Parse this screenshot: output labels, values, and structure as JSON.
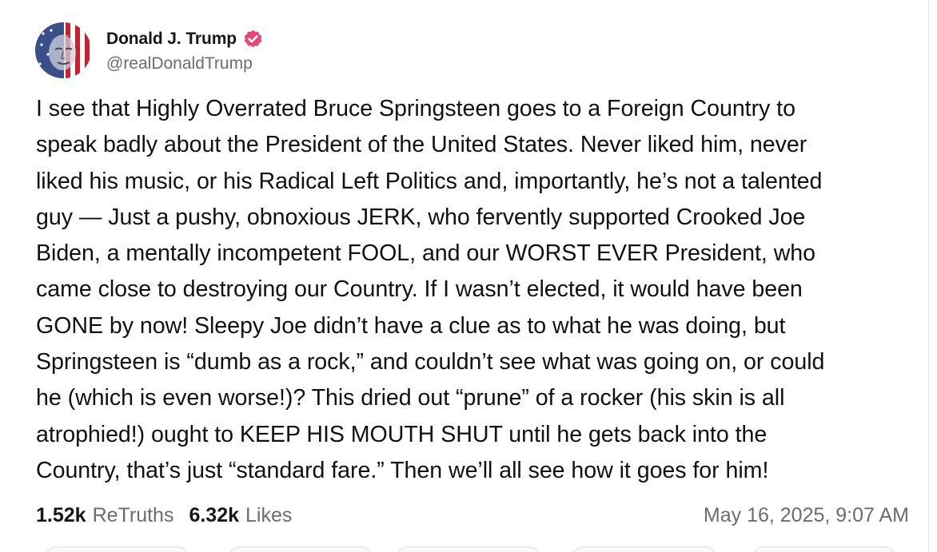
{
  "post": {
    "author": {
      "display_name": "Donald J. Trump",
      "handle": "@realDonaldTrump",
      "verified_icon": "verified-badge-icon",
      "verified_color": "#e4487a"
    },
    "lines": [
      "I see that Highly Overrated Bruce Springsteen goes to a Foreign Country to",
      "speak badly about the President of the United States. Never liked him, never",
      "liked his music, or his Radical Left Politics and, importantly, he’s not a talented",
      "guy — Just a pushy, obnoxious JERK, who fervently supported Crooked Joe",
      "Biden, a mentally incompetent FOOL, and our WORST EVER President, who",
      "came close to destroying our Country. If I wasn’t elected, it would have been",
      "GONE by now! Sleepy Joe didn’t have a clue as to what he was doing, but",
      "Springsteen is “dumb as a rock,” and couldn’t see what was going on, or could",
      "he (which is even worse!)? This dried out “prune” of a rocker (his skin is all",
      "atrophied!) ought to KEEP HIS MOUTH SHUT until he gets back into the",
      "Country, that’s just “standard fare.” Then we’ll all see how it goes for him!"
    ],
    "stats": {
      "retruths_count": "1.52k",
      "retruths_label": "ReTruths",
      "likes_count": "6.32k",
      "likes_label": "Likes"
    },
    "timestamp": "May 16, 2025, 9:07 AM"
  },
  "colors": {
    "text": "#111114",
    "muted": "#6b6b76",
    "border": "#e6e6ea"
  }
}
